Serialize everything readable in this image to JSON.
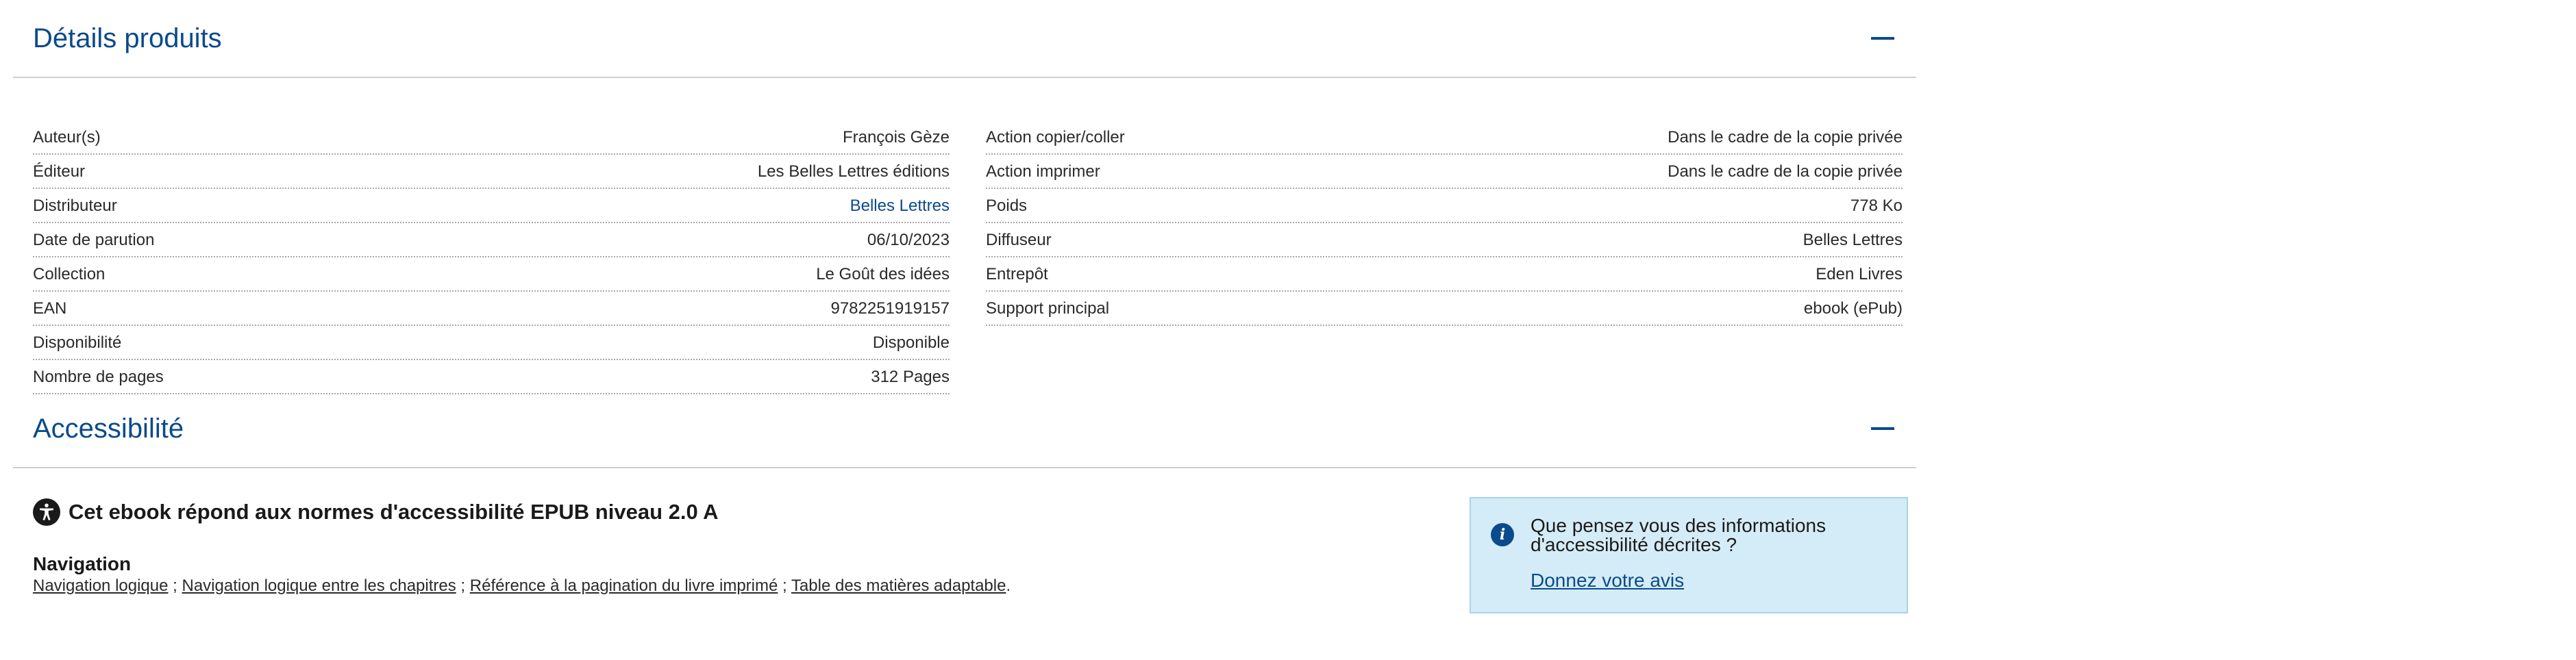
{
  "details_section": {
    "title": "Détails produits",
    "left_rows": [
      {
        "label": "Auteur(s)",
        "value": "François Gèze"
      },
      {
        "label": "Éditeur",
        "value": "Les Belles Lettres éditions"
      },
      {
        "label": "Distributeur",
        "value": "Belles Lettres"
      },
      {
        "label": "Date de parution",
        "value": "06/10/2023"
      },
      {
        "label": "Collection",
        "value": "Le Goût des idées"
      },
      {
        "label": "EAN",
        "value": "9782251919157"
      },
      {
        "label": "Disponibilité",
        "value": "Disponible"
      },
      {
        "label": "Nombre de pages",
        "value": "312 Pages"
      }
    ],
    "right_rows": [
      {
        "label": "Action copier/coller",
        "value": "Dans le cadre de la copie privée"
      },
      {
        "label": "Action imprimer",
        "value": "Dans le cadre de la copie privée"
      },
      {
        "label": "Poids",
        "value": "778 Ko"
      },
      {
        "label": "Diffuseur",
        "value": "Belles Lettres"
      },
      {
        "label": "Entrepôt",
        "value": "Eden Livres"
      },
      {
        "label": "Support principal",
        "value": "ebook (ePub)"
      }
    ]
  },
  "accessibility_section": {
    "title": "Accessibilité",
    "statement": "Cet ebook répond aux normes d'accessibilité EPUB niveau 2.0 A",
    "navigation_title": "Navigation",
    "navigation_links": [
      "Navigation logique",
      "Navigation logique entre les chapitres",
      "Référence à la pagination du livre imprimé",
      "Table des matières adaptable"
    ],
    "separator": " ; ",
    "end_punct": ".",
    "feedback": {
      "question": "Que pensez vous des informations d'accessibilité décrites ?",
      "link": "Donnez votre avis"
    }
  },
  "colors": {
    "accent": "#0b4a8c",
    "feedback_bg": "#d4ecf7"
  },
  "icons": {
    "collapse": "minus-icon",
    "accessibility": "accessibility-person-icon",
    "info": "info-icon"
  }
}
